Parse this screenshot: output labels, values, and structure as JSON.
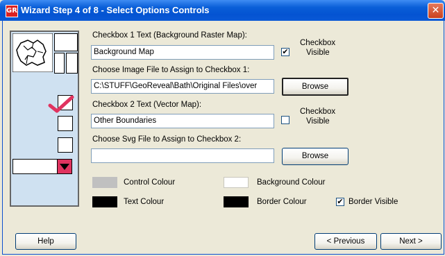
{
  "window": {
    "title": "Wizard Step 4 of 8 - Select Options Controls",
    "app_icon_text": "GR",
    "close_glyph": "✕"
  },
  "checkbox1": {
    "label": "Checkbox 1 Text (Background Raster Map):",
    "value": "Background Map",
    "visible_label_line1": "Checkbox",
    "visible_label_line2": "Visible",
    "visible_checked": true,
    "file_label": "Choose Image File to Assign to Checkbox 1:",
    "file_value": "C:\\STUFF\\GeoReveal\\Bath\\Original Files\\over",
    "browse_label": "Browse"
  },
  "checkbox2": {
    "label": "Checkbox 2 Text (Vector Map):",
    "value": "Other Boundaries",
    "visible_label_line1": "Checkbox",
    "visible_label_line2": "Visible",
    "visible_checked": false,
    "file_label": "Choose Svg File to Assign to Checkbox 2:",
    "file_value": "",
    "browse_label": "Browse"
  },
  "colours": {
    "control_label": "Control Colour",
    "control_color": "#c0c0c0",
    "background_label": "Background Colour",
    "background_color": "#ffffff",
    "text_label": "Text Colour",
    "text_color": "#000000",
    "border_label": "Border Colour",
    "border_color": "#000000",
    "border_visible_label": "Border Visible",
    "border_visible_checked": true
  },
  "preview": {
    "accent_color": "#e0335f",
    "panel_color": "#cfe1f1"
  },
  "footer": {
    "help_label": "Help",
    "previous_label": "< Previous",
    "next_label": "Next >"
  }
}
